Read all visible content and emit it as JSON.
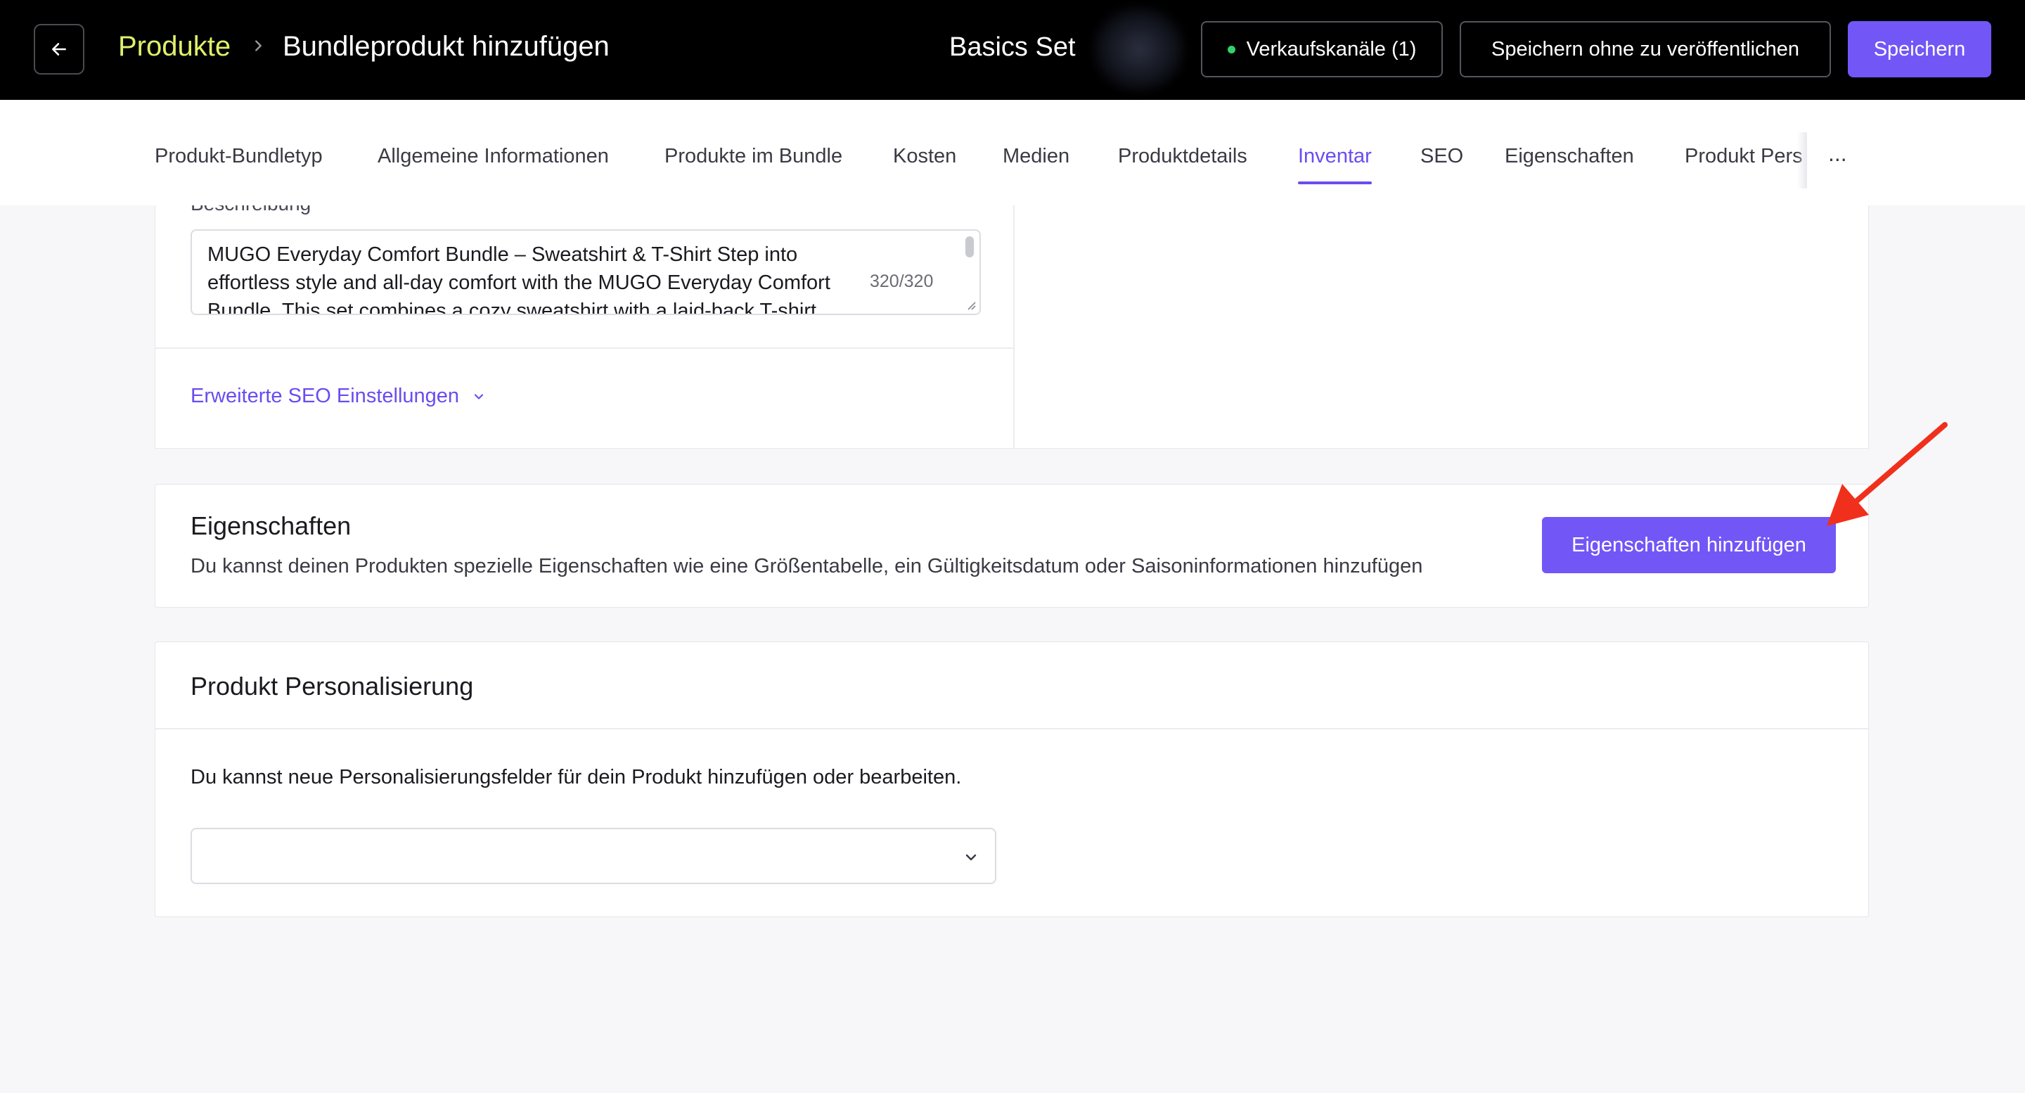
{
  "header": {
    "breadcrumb_root": "Produkte",
    "breadcrumb_current": "Bundleprodukt hinzufügen",
    "product_name": "Basics Set",
    "channels_label": "Verkaufskanäle (1)",
    "save_draft_label": "Speichern ohne zu veröffentlichen",
    "save_label": "Speichern",
    "channel_status_color": "#2fd36a",
    "accent_color": "#7257f6",
    "breadcrumb_color": "#dff06a"
  },
  "tabs": [
    {
      "label": "Produkt-Bundletyp"
    },
    {
      "label": "Allgemeine Informationen"
    },
    {
      "label": "Produkte im Bundle"
    },
    {
      "label": "Kosten"
    },
    {
      "label": "Medien"
    },
    {
      "label": "Produktdetails"
    },
    {
      "label": "Inventar",
      "active": true
    },
    {
      "label": "SEO"
    },
    {
      "label": "Eigenschaften"
    },
    {
      "label": "Produkt Pers"
    }
  ],
  "tabs_more": "...",
  "seo": {
    "description_label": "Beschreibung",
    "description_value": "MUGO Everyday Comfort Bundle – Sweatshirt & T-Shirt Step into effortless style and all-day comfort with the MUGO Everyday Comfort Bundle. This set combines a cozy sweatshirt with a laid-back T-shirt",
    "char_count": "320/320",
    "advanced_link": "Erweiterte SEO Einstellungen"
  },
  "properties": {
    "title": "Eigenschaften",
    "description": "Du kannst deinen Produkten spezielle Eigenschaften wie eine Größentabelle, ein Gültigkeitsdatum oder Saisoninformationen hinzufügen",
    "add_button": "Eigenschaften hinzufügen"
  },
  "personalization": {
    "title": "Produkt Personalisierung",
    "description": "Du kannst neue Personalisierungsfelder für dein Produkt hinzufügen oder bearbeiten.",
    "select_value": ""
  }
}
